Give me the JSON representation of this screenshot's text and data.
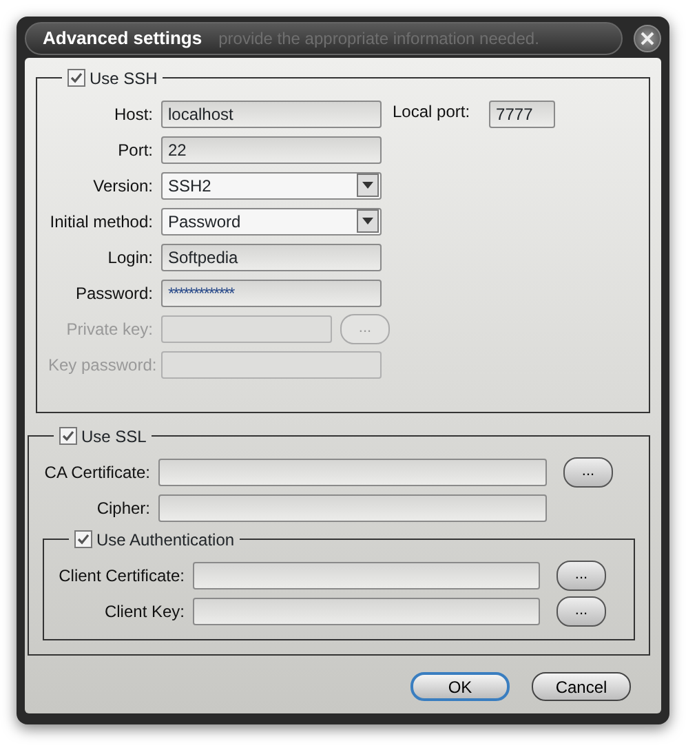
{
  "window": {
    "title": "Advanced settings",
    "background_text": "provide the appropriate information needed."
  },
  "ssh": {
    "label": "Use SSH",
    "checked": true,
    "local_port": {
      "label": "Local port:",
      "value": "7777"
    },
    "fields": [
      {
        "kind": "text",
        "label": "Host:",
        "value": "localhost",
        "disabled": false
      },
      {
        "kind": "text",
        "label": "Port:",
        "value": "22",
        "disabled": false
      },
      {
        "kind": "select",
        "label": "Version:",
        "value": "SSH2",
        "disabled": false
      },
      {
        "kind": "select",
        "label": "Initial method:",
        "value": "Password",
        "disabled": false
      },
      {
        "kind": "text",
        "label": "Login:",
        "value": "Softpedia",
        "disabled": false
      },
      {
        "kind": "text",
        "label": "Password:",
        "value": "*************",
        "disabled": false
      },
      {
        "kind": "browse",
        "label": "Private key:",
        "button": "...",
        "disabled": true
      },
      {
        "kind": "text",
        "label": "Key password:",
        "disabled": true
      }
    ]
  },
  "ssl": {
    "label": "Use SSL",
    "checked": true,
    "fields": [
      {
        "kind": "browse",
        "label": "CA Certificate:",
        "button": "...",
        "disabled": false
      },
      {
        "kind": "text",
        "label": "Cipher:",
        "disabled": false
      }
    ],
    "authentication": {
      "label": "Use Authentication",
      "checked": true,
      "fields": [
        {
          "kind": "browse",
          "label": "Client Certificate:",
          "button": "...",
          "disabled": false
        },
        {
          "kind": "browse",
          "label": "Client Key:",
          "button": "...",
          "disabled": false
        }
      ]
    }
  },
  "buttons": [
    {
      "label": "OK",
      "default": true
    },
    {
      "label": "Cancel",
      "default": false
    }
  ]
}
